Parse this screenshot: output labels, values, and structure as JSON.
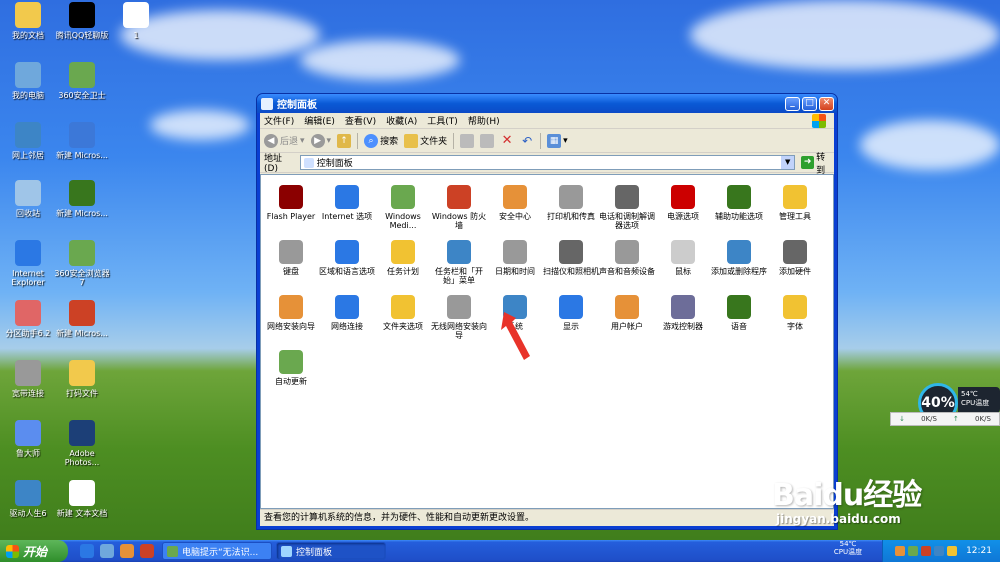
{
  "desktop_icons": [
    {
      "label": "我的文档",
      "icon": "folder-icon",
      "color": "#f2c94c"
    },
    {
      "label": "我的电脑",
      "icon": "computer-icon",
      "color": "#6fa8dc"
    },
    {
      "label": "网上邻居",
      "icon": "network-icon",
      "color": "#3d85c6"
    },
    {
      "label": "回收站",
      "icon": "recycle-bin-icon",
      "color": "#9fc5e8"
    },
    {
      "label": "Internet Explorer",
      "icon": "ie-icon",
      "color": "#2b78e4"
    },
    {
      "label": "分区助手6.2",
      "icon": "partition-icon",
      "color": "#e06666"
    },
    {
      "label": "宽带连接",
      "icon": "broadband-icon",
      "color": "#999999"
    },
    {
      "label": "鲁大师",
      "icon": "ludashi-icon",
      "color": "#5b8def"
    },
    {
      "label": "驱动人生6",
      "icon": "driver-icon",
      "color": "#3d85c6"
    },
    {
      "label": "腾讯QQ轻聊版",
      "icon": "qq-icon",
      "color": "#000000"
    },
    {
      "label": "360安全卫士",
      "icon": "360-safe-icon",
      "color": "#6aa84f"
    },
    {
      "label": "新建 Micros...",
      "icon": "word-doc-icon",
      "color": "#3c78d8"
    },
    {
      "label": "新建 Micros...",
      "icon": "excel-doc-icon",
      "color": "#38761d"
    },
    {
      "label": "360安全浏览器7",
      "icon": "360-browser-icon",
      "color": "#6aa84f"
    },
    {
      "label": "新建 Micros...",
      "icon": "ppt-doc-icon",
      "color": "#cc4125"
    },
    {
      "label": "打码文件",
      "icon": "folder-icon",
      "color": "#f2c94c"
    },
    {
      "label": "Adobe Photos...",
      "icon": "photoshop-icon",
      "color": "#1c3f77"
    },
    {
      "label": "新建 文本文档",
      "icon": "text-doc-icon",
      "color": "#ffffff"
    },
    {
      "label": "1",
      "icon": "file-icon",
      "color": "#ffffff"
    }
  ],
  "window": {
    "title": "控制面板",
    "menu": [
      "文件(F)",
      "编辑(E)",
      "查看(V)",
      "收藏(A)",
      "工具(T)",
      "帮助(H)"
    ],
    "toolbar": {
      "back": "后退",
      "search": "搜索",
      "folders": "文件夹"
    },
    "address_label": "地址(D)",
    "address_value": "控制面板",
    "go_label": "转到",
    "status": "查看您的计算机系统的信息，并为硬件、性能和自动更新更改设置。",
    "items": [
      {
        "label": "Flash Player",
        "icon": "flash-icon",
        "color": "#8b0000"
      },
      {
        "label": "Internet 选项",
        "icon": "internet-options-icon",
        "color": "#2b78e4"
      },
      {
        "label": "Windows Medi...",
        "icon": "windows-media-icon",
        "color": "#6aa84f"
      },
      {
        "label": "Windows 防火墙",
        "icon": "firewall-icon",
        "color": "#cc4125"
      },
      {
        "label": "安全中心",
        "icon": "security-center-icon",
        "color": "#e69138"
      },
      {
        "label": "打印机和传真",
        "icon": "printer-icon",
        "color": "#999999"
      },
      {
        "label": "电话和调制解调器选项",
        "icon": "phone-modem-icon",
        "color": "#666666"
      },
      {
        "label": "电源选项",
        "icon": "power-icon",
        "color": "#cc0000"
      },
      {
        "label": "辅助功能选项",
        "icon": "accessibility-icon",
        "color": "#38761d"
      },
      {
        "label": "管理工具",
        "icon": "admin-tools-icon",
        "color": "#f1c232"
      },
      {
        "label": "键盘",
        "icon": "keyboard-icon",
        "color": "#999999"
      },
      {
        "label": "区域和语言选项",
        "icon": "region-language-icon",
        "color": "#2b78e4"
      },
      {
        "label": "任务计划",
        "icon": "scheduled-tasks-icon",
        "color": "#f1c232"
      },
      {
        "label": "任务栏和「开始」菜单",
        "icon": "taskbar-start-icon",
        "color": "#3d85c6"
      },
      {
        "label": "日期和时间",
        "icon": "datetime-icon",
        "color": "#999999"
      },
      {
        "label": "扫描仪和照相机",
        "icon": "scanner-camera-icon",
        "color": "#666666"
      },
      {
        "label": "声音和音频设备",
        "icon": "sound-icon",
        "color": "#999999"
      },
      {
        "label": "鼠标",
        "icon": "mouse-icon",
        "color": "#cccccc"
      },
      {
        "label": "添加或删除程序",
        "icon": "add-remove-programs-icon",
        "color": "#3d85c6"
      },
      {
        "label": "添加硬件",
        "icon": "add-hardware-icon",
        "color": "#666666"
      },
      {
        "label": "网络安装向导",
        "icon": "network-setup-icon",
        "color": "#e69138"
      },
      {
        "label": "网络连接",
        "icon": "network-connections-icon",
        "color": "#2b78e4"
      },
      {
        "label": "文件夹选项",
        "icon": "folder-options-icon",
        "color": "#f1c232"
      },
      {
        "label": "无线网络安装向导",
        "icon": "wireless-setup-icon",
        "color": "#999999"
      },
      {
        "label": "系统",
        "icon": "system-icon",
        "color": "#3d85c6"
      },
      {
        "label": "显示",
        "icon": "display-icon",
        "color": "#2b78e4"
      },
      {
        "label": "用户帐户",
        "icon": "user-accounts-icon",
        "color": "#e69138"
      },
      {
        "label": "游戏控制器",
        "icon": "game-controller-icon",
        "color": "#6d6d99"
      },
      {
        "label": "语音",
        "icon": "speech-icon",
        "color": "#38761d"
      },
      {
        "label": "字体",
        "icon": "fonts-icon",
        "color": "#f1c232"
      },
      {
        "label": "自动更新",
        "icon": "auto-update-icon",
        "color": "#6aa84f"
      }
    ]
  },
  "taskbar": {
    "start_label": "开始",
    "tasks": [
      {
        "label": "电脑提示“无法识...",
        "active": false
      },
      {
        "label": "控制面板",
        "active": true
      }
    ],
    "cpu_temp": "54℃",
    "cpu_temp_label": "CPU温度",
    "clock": "12:21"
  },
  "cpu_widget": {
    "percent": "40%",
    "temp": "54℃",
    "temp_label": "CPU温度",
    "down": "0K/S",
    "up": "0K/S"
  },
  "watermark": {
    "brand": "Baidu经验",
    "url": "jingyan.baidu.com"
  }
}
